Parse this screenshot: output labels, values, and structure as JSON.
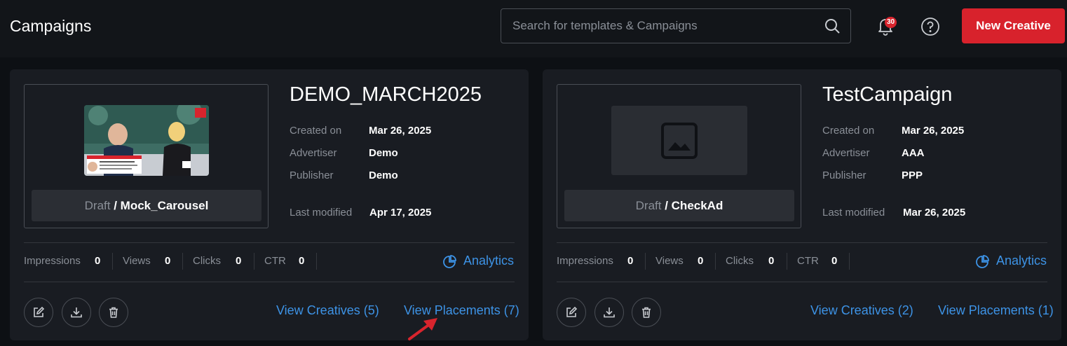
{
  "header": {
    "title": "Campaigns",
    "search_placeholder": "Search for templates & Campaigns",
    "notification_count": "30",
    "new_button": "New Creative"
  },
  "labels": {
    "created_on": "Created on",
    "advertiser": "Advertiser",
    "publisher": "Publisher",
    "last_modified": "Last modified",
    "impressions": "Impressions",
    "views": "Views",
    "clicks": "Clicks",
    "ctr": "CTR",
    "analytics": "Analytics"
  },
  "campaigns": [
    {
      "name": "DEMO_MARCH2025",
      "status": "Draft",
      "creative": " / Mock_Carousel",
      "created_on": "Mar 26, 2025",
      "advertiser": "Demo",
      "publisher": "Demo",
      "last_modified": "Apr 17, 2025",
      "impressions": "0",
      "views": "0",
      "clicks": "0",
      "ctr": "0",
      "view_creatives": "View Creatives (5)",
      "view_placements": "View Placements (7)",
      "thumbnail": {
        "logo_text": "The Morning Show",
        "caption": "CHRIST MURDOCK"
      }
    },
    {
      "name": "TestCampaign",
      "status": "Draft",
      "creative": " / CheckAd",
      "created_on": "Mar 26, 2025",
      "advertiser": "AAA",
      "publisher": "PPP",
      "last_modified": "Mar 26, 2025",
      "impressions": "0",
      "views": "0",
      "clicks": "0",
      "ctr": "0",
      "view_creatives": "View Creatives (2)",
      "view_placements": "View Placements (1)"
    }
  ],
  "colors": {
    "accent": "#3d93e6",
    "brand_red": "#d8222c",
    "annotation_arrow": "#d8242d"
  }
}
